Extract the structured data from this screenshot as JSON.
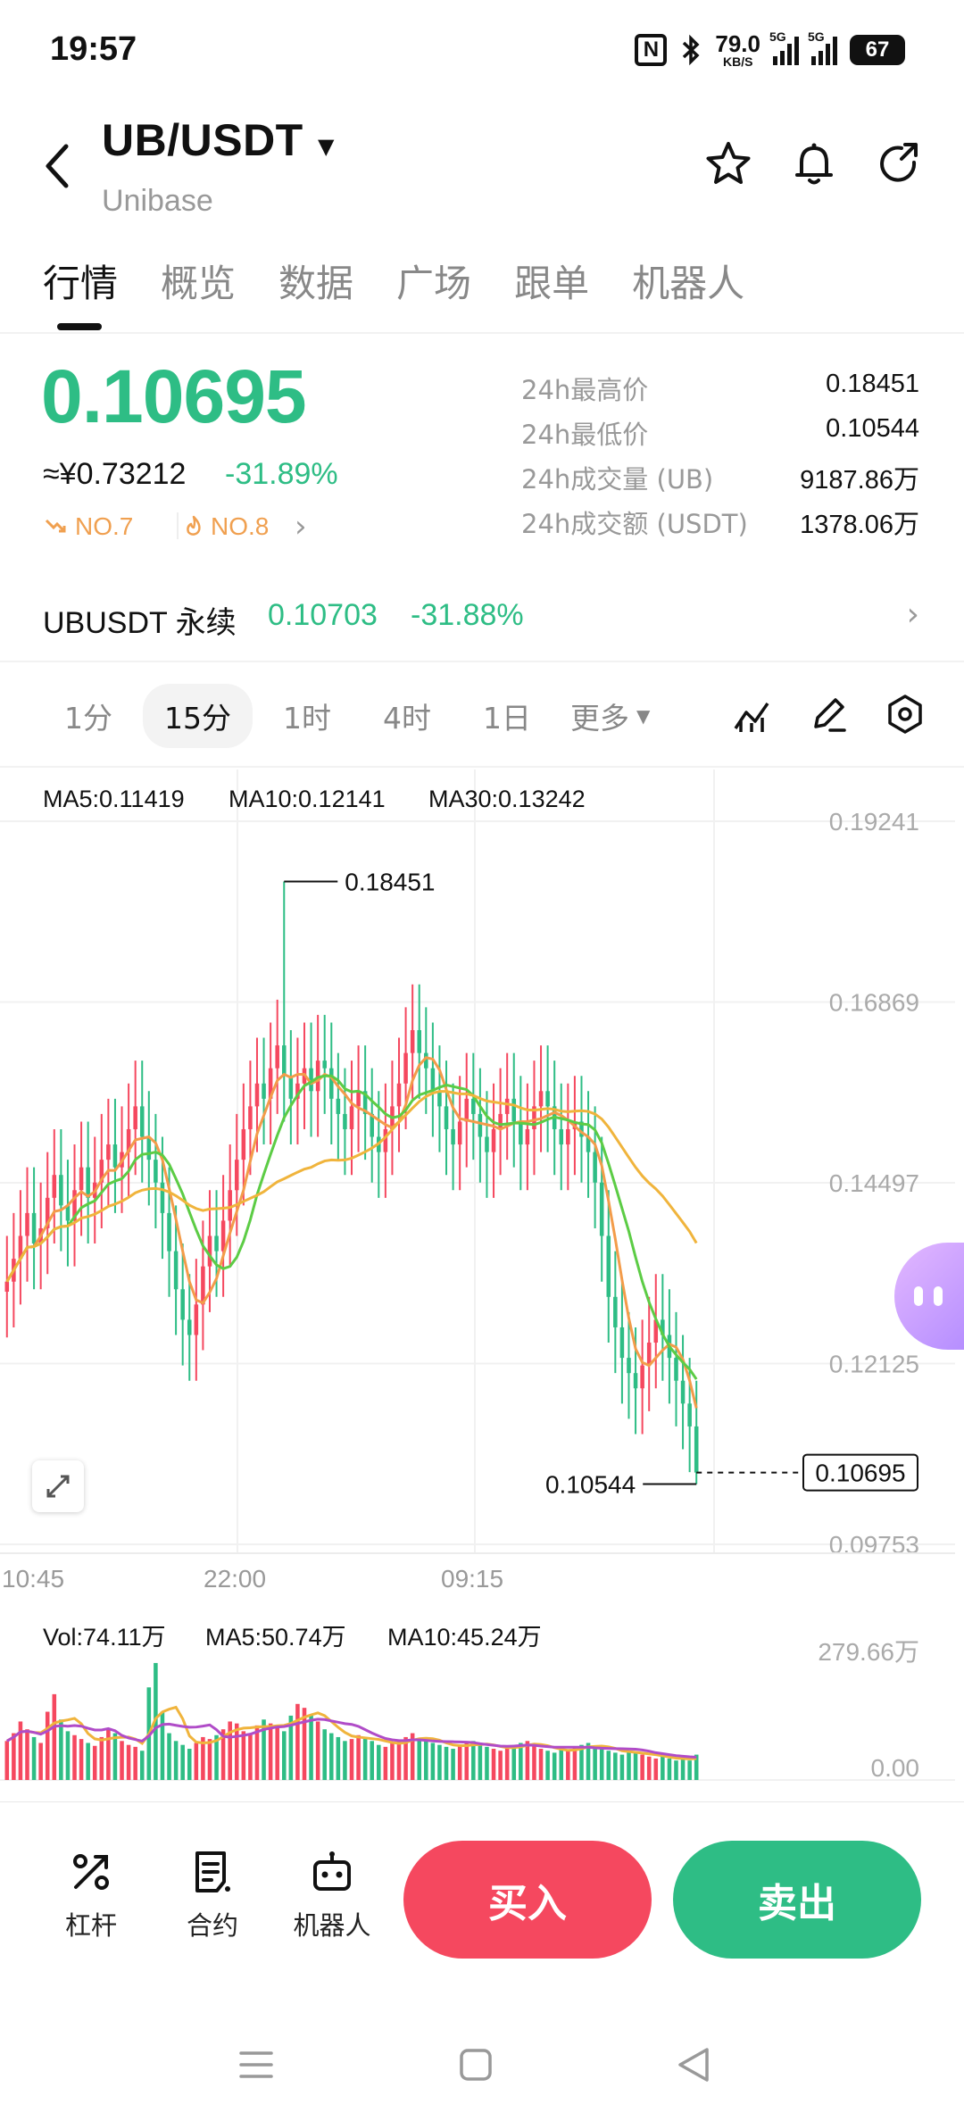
{
  "status_bar": {
    "time": "19:57",
    "net_speed": "79.0",
    "net_unit": "KB/S",
    "sig1": "5G",
    "sig2": "5G",
    "battery": "67"
  },
  "header": {
    "pair": "UB/USDT",
    "name": "Unibase"
  },
  "tabs": [
    {
      "label": "行情",
      "active": true
    },
    {
      "label": "概览"
    },
    {
      "label": "数据"
    },
    {
      "label": "广场"
    },
    {
      "label": "跟单"
    },
    {
      "label": "机器人"
    }
  ],
  "price": {
    "last": "0.10695",
    "cny": "≈¥0.73212",
    "change": "-31.89%",
    "rank1": "NO.7",
    "rank2": "NO.8",
    "color_down": "#2ebd85",
    "color_up": "#f5485f"
  },
  "stats": [
    {
      "label": "24h最高价",
      "value": "0.18451"
    },
    {
      "label": "24h最低价",
      "value": "0.10544"
    },
    {
      "label": "24h成交量 (UB)",
      "value": "9187.86万"
    },
    {
      "label": "24h成交额 (USDT)",
      "value": "1378.06万"
    }
  ],
  "perpetual": {
    "name": "UBUSDT 永续",
    "price": "0.10703",
    "change": "-31.88%"
  },
  "intervals": [
    "1分",
    "15分",
    "1时",
    "4时",
    "1日"
  ],
  "interval_active": "15分",
  "interval_more": "更多",
  "chart_data": {
    "type": "candlestick",
    "ma_legend": {
      "ma5": "MA5:0.11419",
      "ma10": "MA10:0.12141",
      "ma30": "MA30:0.13242"
    },
    "colors": {
      "up": "#f5485f",
      "down": "#2ebd85",
      "ma5": "#f39c4a",
      "ma10": "#5ccc45",
      "ma30": "#f0b43c",
      "vol_ma10": "#b04cc8"
    },
    "y_ticks": [
      "0.19241",
      "0.16869",
      "0.14497",
      "0.12125",
      "0.09753"
    ],
    "ylim": [
      0.09753,
      0.19241
    ],
    "x_ticks": [
      "10:45",
      "22:00",
      "09:15"
    ],
    "high_label": "0.18451",
    "low_label": "0.10544",
    "last_label": "0.10695",
    "closes": [
      0.132,
      0.135,
      0.138,
      0.141,
      0.137,
      0.139,
      0.143,
      0.146,
      0.142,
      0.14,
      0.144,
      0.147,
      0.143,
      0.145,
      0.148,
      0.15,
      0.147,
      0.149,
      0.152,
      0.155,
      0.151,
      0.148,
      0.145,
      0.141,
      0.136,
      0.131,
      0.127,
      0.125,
      0.129,
      0.134,
      0.138,
      0.136,
      0.14,
      0.144,
      0.148,
      0.152,
      0.155,
      0.158,
      0.156,
      0.16,
      0.163,
      0.159,
      0.156,
      0.158,
      0.16,
      0.157,
      0.161,
      0.16,
      0.156,
      0.154,
      0.152,
      0.155,
      0.157,
      0.154,
      0.151,
      0.149,
      0.152,
      0.155,
      0.158,
      0.162,
      0.165,
      0.162,
      0.16,
      0.157,
      0.155,
      0.152,
      0.15,
      0.153,
      0.156,
      0.154,
      0.151,
      0.149,
      0.152,
      0.154,
      0.156,
      0.153,
      0.15,
      0.152,
      0.155,
      0.157,
      0.155,
      0.152,
      0.15,
      0.152,
      0.153,
      0.151,
      0.149,
      0.145,
      0.138,
      0.13,
      0.126,
      0.122,
      0.12,
      0.118,
      0.121,
      0.124,
      0.127,
      0.125,
      0.122,
      0.119,
      0.116,
      0.113,
      0.10695
    ],
    "volume_ticks": [
      "279.66万",
      "0.00"
    ],
    "volume_legend": {
      "vol": "Vol:74.11万",
      "ma5": "MA5:50.74万",
      "ma10": "MA10:45.24万"
    },
    "volumes": [
      40,
      48,
      60,
      52,
      44,
      38,
      70,
      88,
      62,
      50,
      46,
      42,
      38,
      35,
      44,
      52,
      48,
      40,
      36,
      34,
      30,
      95,
      120,
      70,
      48,
      40,
      36,
      32,
      38,
      44,
      42,
      46,
      52,
      60,
      58,
      50,
      48,
      56,
      62,
      58,
      54,
      50,
      66,
      78,
      74,
      66,
      60,
      52,
      48,
      44,
      40,
      42,
      46,
      44,
      40,
      36,
      34,
      38,
      40,
      44,
      48,
      42,
      40,
      38,
      36,
      34,
      32,
      36,
      38,
      40,
      36,
      34,
      32,
      30,
      34,
      36,
      38,
      40,
      36,
      32,
      30,
      28,
      32,
      30,
      34,
      36,
      38,
      34,
      32,
      30,
      28,
      26,
      30,
      28,
      26,
      24,
      22,
      24,
      22,
      20,
      22,
      20,
      26
    ]
  },
  "actions": [
    {
      "label": "杠杆",
      "icon": "leverage-icon"
    },
    {
      "label": "合约",
      "icon": "contract-icon"
    },
    {
      "label": "机器人",
      "icon": "robot-icon"
    }
  ],
  "buy_label": "买入",
  "sell_label": "卖出"
}
